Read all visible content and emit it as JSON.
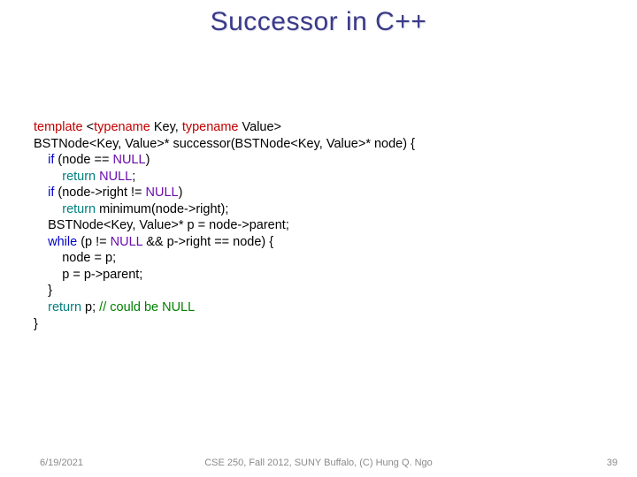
{
  "title": "Successor in C++",
  "code": {
    "l1_a": "template",
    "l1_b": " <",
    "l1_c": "typename",
    "l1_d": " Key, ",
    "l1_e": "typename",
    "l1_f": " Value>",
    "l2": "BSTNode<Key, Value>* successor(BSTNode<Key, Value>* node) {",
    "l3_a": "    ",
    "l3_b": "if",
    "l3_c": " (node == ",
    "l3_d": "NULL",
    "l3_e": ")",
    "l4_a": "        ",
    "l4_b": "return",
    "l4_c": " ",
    "l4_d": "NULL",
    "l4_e": ";",
    "l5_a": "    ",
    "l5_b": "if",
    "l5_c": " (node->right != ",
    "l5_d": "NULL",
    "l5_e": ")",
    "l6_a": "        ",
    "l6_b": "return",
    "l6_c": " minimum(node->right);",
    "l7": "    BSTNode<Key, Value>* p = node->parent;",
    "l8_a": "    ",
    "l8_b": "while",
    "l8_c": " (p != ",
    "l8_d": "NULL",
    "l8_e": " && p->right == node) {",
    "l9": "        node = p;",
    "l10": "        p = p->parent;",
    "l11": "    }",
    "l12_a": "    ",
    "l12_b": "return",
    "l12_c": " p; ",
    "l12_d": "// could be NULL",
    "l13": "}"
  },
  "footer": {
    "date": "6/19/2021",
    "course": "CSE 250, Fall 2012, SUNY Buffalo, (C) Hung Q. Ngo",
    "page": "39"
  }
}
